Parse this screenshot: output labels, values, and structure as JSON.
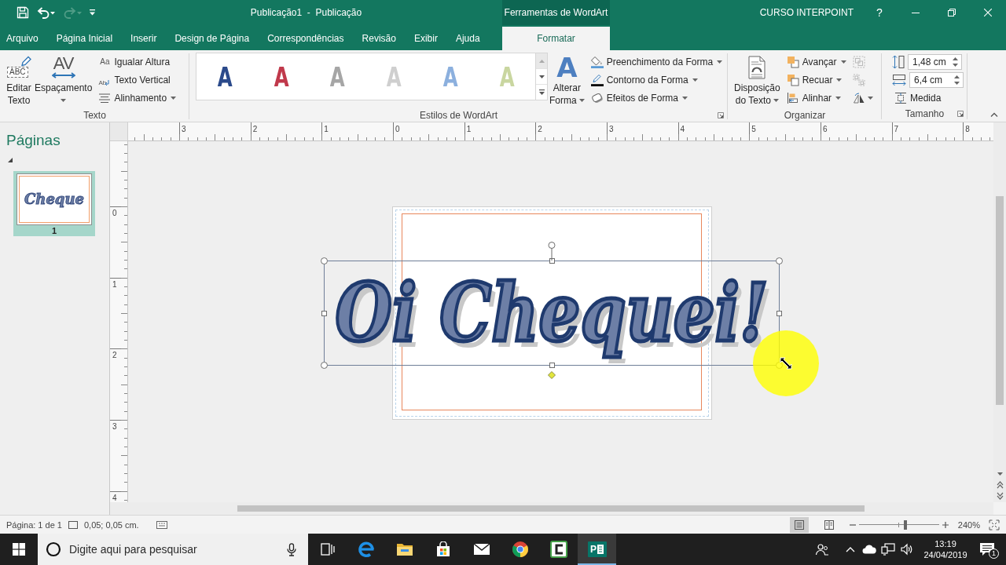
{
  "title_bar": {
    "quick_access": [
      {
        "kind": "save",
        "disabled": false
      },
      {
        "kind": "undo",
        "disabled": false
      },
      {
        "kind": "redo",
        "disabled": true
      },
      {
        "kind": "customize",
        "disabled": false
      }
    ],
    "title": "Publicação1  -  Publicação",
    "context_group": "Ferramentas de WordArt",
    "account": "CURSO INTERPOINT",
    "help": "?"
  },
  "tabs": [
    {
      "label": "Arquivo",
      "selected": false,
      "contextual": false
    },
    {
      "label": "Página Inicial",
      "selected": false,
      "contextual": false
    },
    {
      "label": "Inserir",
      "selected": false,
      "contextual": false
    },
    {
      "label": "Design de Página",
      "selected": false,
      "contextual": false
    },
    {
      "label": "Correspondências",
      "selected": false,
      "contextual": false
    },
    {
      "label": "Revisão",
      "selected": false,
      "contextual": false
    },
    {
      "label": "Exibir",
      "selected": false,
      "contextual": false
    },
    {
      "label": "Ajuda",
      "selected": false,
      "contextual": false
    },
    {
      "label": "Formatar",
      "selected": true,
      "contextual": true
    }
  ],
  "ribbon": {
    "groups": [
      {
        "title": "Texto",
        "launcher": false,
        "sections": [
          {
            "kind": "large",
            "items": [
              {
                "kind": "edit-text",
                "glyph": "ABC",
                "lines": [
                  "Editar",
                  "Texto"
                ],
                "dropdown": false
              },
              {
                "kind": "spacing",
                "glyph": "AV",
                "lines": [
                  "Espaçamento"
                ],
                "dropdown": true
              }
            ]
          },
          {
            "kind": "small",
            "items": [
              {
                "kind": "equal-height",
                "glyph": "Aa",
                "label": "Igualar Altura",
                "dropdown": false
              },
              {
                "kind": "vertical-text",
                "glyph": "Ab",
                "label": "Texto Vertical",
                "dropdown": false
              },
              {
                "kind": "align-text",
                "label": "Alinhamento",
                "dropdown": true
              }
            ]
          }
        ]
      },
      {
        "title": "Estilos de WordArt",
        "launcher": true,
        "sections": [
          {
            "kind": "gallery",
            "items": [
              {
                "letter": "A",
                "color": "#2b4a8b"
              },
              {
                "letter": "A",
                "color": "#c0394b"
              },
              {
                "letter": "A",
                "color": "#a6a6a6"
              },
              {
                "letter": "A",
                "color": "#cfcfcf"
              },
              {
                "letter": "A",
                "color": "#8cb0de"
              },
              {
                "letter": "A",
                "color": "#c9d6a0"
              }
            ]
          },
          {
            "kind": "large",
            "items": [
              {
                "kind": "change-shape",
                "glyph": "A",
                "lines": [
                  "Alterar",
                  "Forma"
                ],
                "dropdown": true
              }
            ]
          },
          {
            "kind": "small",
            "items": [
              {
                "kind": "fill",
                "label": "Preenchimento da Forma",
                "dropdown": true
              },
              {
                "kind": "outline",
                "label": "Contorno da Forma",
                "dropdown": true
              },
              {
                "kind": "effects",
                "label": "Efeitos de Forma",
                "dropdown": true
              }
            ]
          }
        ]
      },
      {
        "title": "Organizar",
        "launcher": false,
        "sections": [
          {
            "kind": "large",
            "items": [
              {
                "kind": "wrap-text",
                "lines": [
                  "Disposição",
                  "do Texto"
                ],
                "dropdown": true
              }
            ]
          },
          {
            "kind": "small",
            "items": [
              {
                "kind": "bring-forward",
                "label": "Avançar",
                "dropdown": true
              },
              {
                "kind": "send-backward",
                "label": "Recuar",
                "dropdown": true
              },
              {
                "kind": "align",
                "label": "Alinhar",
                "dropdown": true
              }
            ]
          },
          {
            "kind": "icons",
            "items": [
              {
                "kind": "group",
                "disabled": true,
                "dropdown": false
              },
              {
                "kind": "ungroup",
                "disabled": true,
                "dropdown": false
              },
              {
                "kind": "rotate",
                "disabled": false,
                "dropdown": true
              }
            ]
          }
        ]
      },
      {
        "title": "Tamanho",
        "launcher": true,
        "sections": [
          {
            "kind": "small",
            "items": [
              {
                "kind": "height-field",
                "value": "1,48 cm"
              },
              {
                "kind": "width-field",
                "value": "6,4 cm"
              },
              {
                "kind": "measure",
                "label": "Medida",
                "dropdown": false
              }
            ]
          }
        ]
      }
    ]
  },
  "pages_pane": {
    "title": "Páginas",
    "pages": [
      {
        "thumbnail_text": "Cheque",
        "number": "1",
        "selected": true
      }
    ]
  },
  "rulers": {
    "horizontal": [
      "3",
      "2",
      "1",
      "0",
      "1",
      "2",
      "3",
      "4",
      "5",
      "6",
      "7",
      "8"
    ],
    "vertical": [
      "0",
      "1",
      "2",
      "3",
      "4"
    ]
  },
  "canvas": {
    "wordart": {
      "text": "Oi Chequei!",
      "selected": true
    }
  },
  "status_bar": {
    "page": "Página: 1 de 1",
    "position": "0,05; 0,05 cm.",
    "views": [
      {
        "kind": "single-page",
        "selected": true
      },
      {
        "kind": "two-page",
        "selected": false
      }
    ],
    "zoom": {
      "level": 0.58,
      "value": "240%"
    }
  },
  "taskbar": {
    "search": {
      "placeholder": "Digite aqui para pesquisar"
    },
    "apps": [
      {
        "kind": "task-view",
        "active": false
      },
      {
        "kind": "browser-e",
        "active": false
      },
      {
        "kind": "folder",
        "active": false
      },
      {
        "kind": "store",
        "active": false
      },
      {
        "kind": "mail",
        "active": false
      },
      {
        "kind": "browser-ring",
        "active": false
      },
      {
        "kind": "recorder",
        "active": false
      },
      {
        "kind": "publisher",
        "glyph": "P",
        "active": true
      }
    ],
    "tray": {
      "time": "13:19",
      "date": "24/04/2019",
      "notifications": "1"
    }
  }
}
